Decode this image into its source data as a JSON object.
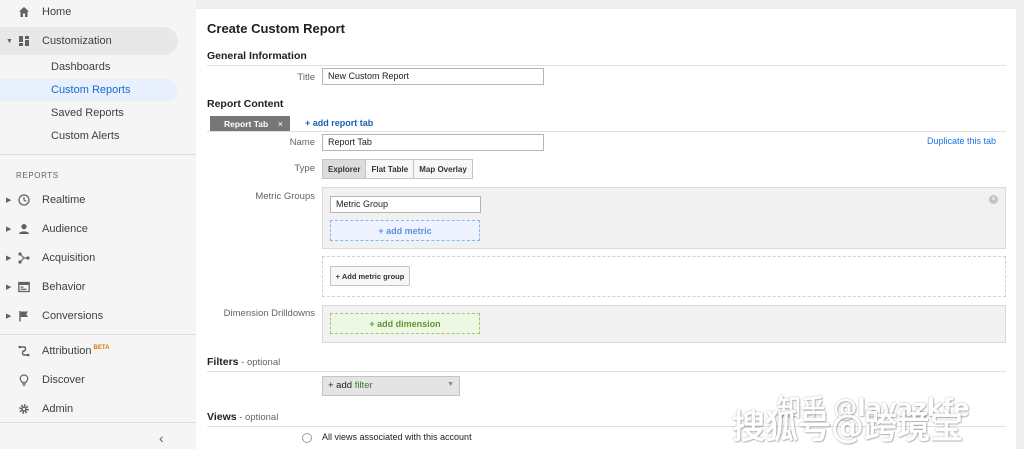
{
  "sidebar": {
    "home": "Home",
    "customization": "Customization",
    "customization_items": [
      "Dashboards",
      "Custom Reports",
      "Saved Reports",
      "Custom Alerts"
    ],
    "reports_heading": "REPORTS",
    "report_items": [
      "Realtime",
      "Audience",
      "Acquisition",
      "Behavior",
      "Conversions"
    ],
    "attribution": "Attribution",
    "attribution_badge": "BETA",
    "discover": "Discover",
    "admin": "Admin",
    "collapse_glyph": "‹"
  },
  "main": {
    "title": "Create Custom Report",
    "general_info": "General Information",
    "title_label": "Title",
    "title_value": "New Custom Report",
    "report_content": "Report Content",
    "tab_name": "Report Tab",
    "tab_close": "×",
    "add_report_tab": "+ add report tab",
    "name_label": "Name",
    "name_value": "Report Tab",
    "duplicate_tab": "Duplicate this tab",
    "type_label": "Type",
    "types": [
      "Explorer",
      "Flat Table",
      "Map Overlay"
    ],
    "metric_groups_label": "Metric Groups",
    "metric_group_value": "Metric Group",
    "add_metric": "+ add metric",
    "add_metric_group": "+ Add metric group",
    "dimension_label": "Dimension Drilldowns",
    "add_dimension": "+ add dimension",
    "filters": "Filters",
    "filters_optional": " - optional",
    "add_filter_prefix": "+ add ",
    "add_filter_word": "filter",
    "views": "Views",
    "views_optional": " - optional",
    "all_views": "All views associated with this account"
  },
  "watermark": {
    "line1": "知乎 @layazkfe",
    "line2": "搜狐号@跨境宝"
  },
  "colors": {
    "accent": "#1a73e8",
    "selected_bg": "#e8f0fe",
    "green": "#3a7d2c",
    "beta": "#e37400"
  }
}
